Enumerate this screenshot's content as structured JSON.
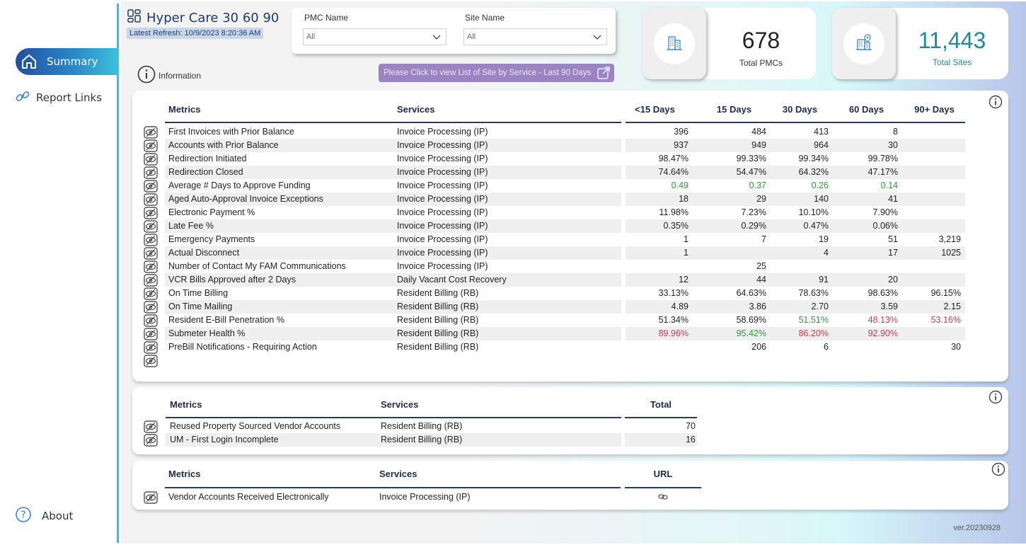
{
  "nav": {
    "summary": "Summary",
    "report_links": "Report Links",
    "about": "About"
  },
  "header": {
    "title": "Hyper Care 30 60 90",
    "refresh": "Latest Refresh: 10/9/2023 8:20:36 AM"
  },
  "filters": {
    "pmc_label": "PMC Name",
    "pmc_value": "All",
    "site_label": "Site Name",
    "site_value": "All"
  },
  "info_label": "Information",
  "list_button": "Please Click to view List of Site by Service - Last 90 Days",
  "kpis": {
    "pmcs_value": "678",
    "pmcs_label": "Total PMCs",
    "sites_value": "11,443",
    "sites_label": "Total Sites"
  },
  "colors": {
    "accent": "#1f4fa3",
    "teal": "#1e8a9a",
    "green": "#2a9a3d",
    "red": "#d0394e",
    "button": "#9c84c4"
  },
  "table1": {
    "headers": [
      "Metrics",
      "Services",
      "<15 Days",
      "15 Days",
      "30 Days",
      "60 Days",
      "90+ Days"
    ],
    "rows": [
      {
        "metric": "First Invoices with Prior Balance",
        "service": "Invoice Processing (IP)",
        "v": [
          "396",
          "484",
          "413",
          "8",
          ""
        ],
        "cls": [
          "",
          "",
          "",
          "",
          ""
        ]
      },
      {
        "metric": "Accounts with Prior Balance",
        "service": "Invoice Processing (IP)",
        "v": [
          "937",
          "949",
          "964",
          "30",
          ""
        ],
        "cls": [
          "",
          "",
          "",
          "",
          ""
        ]
      },
      {
        "metric": "Redirection Initiated",
        "service": "Invoice Processing (IP)",
        "v": [
          "98.47%",
          "99.33%",
          "99.34%",
          "99.78%",
          ""
        ],
        "cls": [
          "",
          "",
          "",
          "",
          ""
        ]
      },
      {
        "metric": "Redirection Closed",
        "service": "Invoice Processing (IP)",
        "v": [
          "74.64%",
          "54.47%",
          "64.32%",
          "47.17%",
          ""
        ],
        "cls": [
          "",
          "",
          "",
          "",
          ""
        ]
      },
      {
        "metric": "Average # Days to Approve Funding",
        "service": "Invoice Processing (IP)",
        "v": [
          "0.49",
          "0.37",
          "0.26",
          "0.14",
          ""
        ],
        "cls": [
          "green",
          "green",
          "green",
          "green",
          ""
        ]
      },
      {
        "metric": "Aged Auto-Approval Invoice Exceptions",
        "service": "Invoice Processing (IP)",
        "v": [
          "18",
          "29",
          "140",
          "41",
          ""
        ],
        "cls": [
          "",
          "",
          "",
          "",
          ""
        ]
      },
      {
        "metric": "Electronic Payment %",
        "service": "Invoice Processing (IP)",
        "v": [
          "11.98%",
          "7.23%",
          "10.10%",
          "7.90%",
          ""
        ],
        "cls": [
          "",
          "",
          "",
          "",
          ""
        ]
      },
      {
        "metric": "Late Fee %",
        "service": "Invoice Processing (IP)",
        "v": [
          "0.35%",
          "0.29%",
          "0.47%",
          "0.06%",
          ""
        ],
        "cls": [
          "",
          "",
          "",
          "",
          ""
        ]
      },
      {
        "metric": "Emergency Payments",
        "service": "Invoice Processing (IP)",
        "v": [
          "1",
          "7",
          "19",
          "51",
          "3,219"
        ],
        "cls": [
          "",
          "",
          "",
          "",
          ""
        ]
      },
      {
        "metric": "Actual Disconnect",
        "service": "Invoice Processing (IP)",
        "v": [
          "1",
          "",
          "4",
          "17",
          "1025"
        ],
        "cls": [
          "",
          "",
          "",
          "",
          ""
        ]
      },
      {
        "metric": "Number of Contact My FAM Communications",
        "service": "Invoice Processing (IP)",
        "v": [
          "",
          "25",
          "",
          "",
          ""
        ],
        "cls": [
          "",
          "",
          "",
          "",
          ""
        ]
      },
      {
        "metric": "VCR Bills Approved after  2 Days",
        "service": "Daily Vacant Cost Recovery",
        "v": [
          "12",
          "44",
          "91",
          "20",
          ""
        ],
        "cls": [
          "",
          "",
          "",
          "",
          ""
        ]
      },
      {
        "metric": "On Time Billing",
        "service": "Resident Billing (RB)",
        "v": [
          "33.13%",
          "64.63%",
          "78.63%",
          "98.63%",
          "96.15%"
        ],
        "cls": [
          "",
          "",
          "",
          "",
          ""
        ]
      },
      {
        "metric": "On Time Mailing",
        "service": "Resident Billing (RB)",
        "v": [
          "4.89",
          "3.86",
          "2.70",
          "3.59",
          "2.15"
        ],
        "cls": [
          "",
          "",
          "",
          "",
          ""
        ]
      },
      {
        "metric": "Resident E-Bill Penetration %",
        "service": "Resident Billing (RB)",
        "v": [
          "51.34%",
          "58.69%",
          "51.51%",
          "48.13%",
          "53.16%"
        ],
        "cls": [
          "",
          "",
          "green",
          "red",
          "red"
        ]
      },
      {
        "metric": "Submeter Health %",
        "service": "Resident Billing (RB)",
        "v": [
          "89.96%",
          "95.42%",
          "86.20%",
          "92.90%",
          ""
        ],
        "cls": [
          "red",
          "green",
          "red",
          "red",
          ""
        ]
      },
      {
        "metric": "PreBill Notifications - Requiring Action",
        "service": "Resident Billing (RB)",
        "v": [
          "",
          "206",
          "6",
          "",
          "30"
        ],
        "cls": [
          "",
          "",
          "",
          "",
          ""
        ]
      }
    ]
  },
  "table2": {
    "headers": [
      "Metrics",
      "Services",
      "Total"
    ],
    "rows": [
      {
        "metric": "Reused Property Sourced Vendor Accounts",
        "service": "Resident Billing (RB)",
        "total": "70"
      },
      {
        "metric": "UM - First Login Incomplete",
        "service": "Resident Billing (RB)",
        "total": "16"
      }
    ]
  },
  "table3": {
    "headers": [
      "Metrics",
      "Services",
      "URL"
    ],
    "rows": [
      {
        "metric": "Vendor Accounts Received Electronically",
        "service": "Invoice Processing (IP)",
        "url_icon": "link-icon"
      }
    ]
  },
  "version": "ver.20230928"
}
